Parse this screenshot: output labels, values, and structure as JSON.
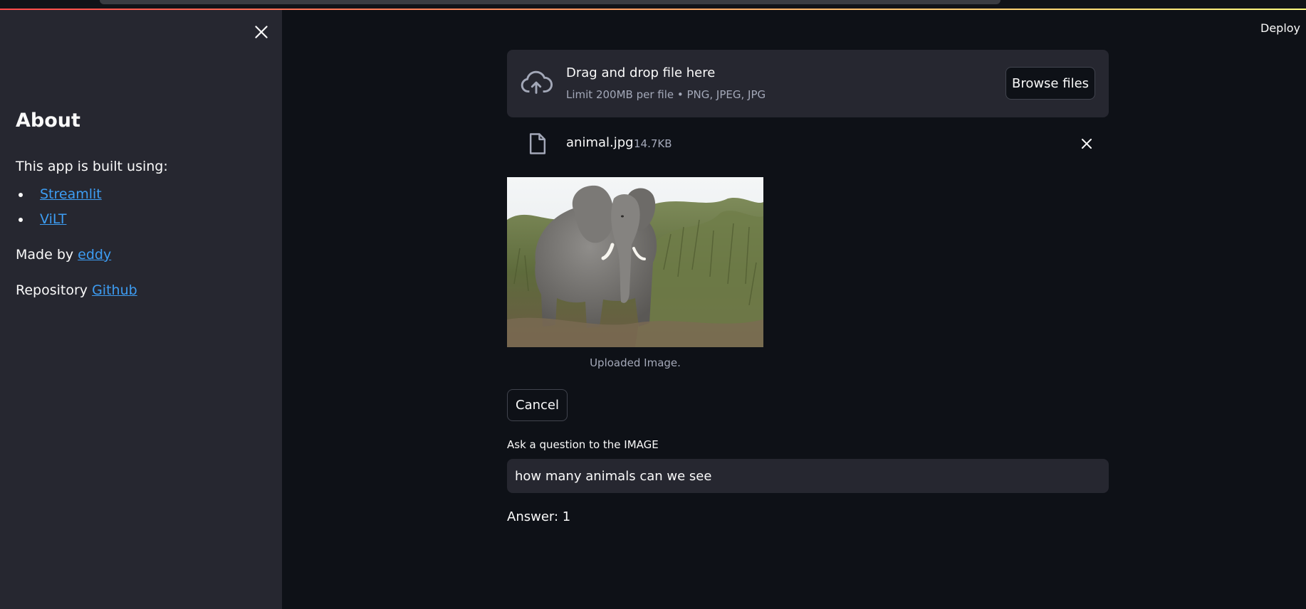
{
  "sidebar": {
    "title": "About",
    "intro": "This app is built using:",
    "links": [
      {
        "label": "Streamlit"
      },
      {
        "label": "ViLT"
      }
    ],
    "made_by_prefix": "Made by ",
    "made_by_link": "eddy",
    "repo_prefix": "Repository ",
    "repo_link": "Github"
  },
  "header": {
    "deploy_label": "Deploy"
  },
  "uploader": {
    "title": "Drag and drop file here",
    "limit": "Limit 200MB per file • PNG, JPEG, JPG",
    "browse_label": "Browse files"
  },
  "file": {
    "name": "animal.jpg",
    "size": "14.7KB"
  },
  "image": {
    "caption": "Uploaded Image."
  },
  "actions": {
    "cancel_label": "Cancel"
  },
  "question": {
    "label": "Ask a question to the IMAGE",
    "value": "how many animals can we see"
  },
  "answer": {
    "text": "Answer: 1"
  },
  "colors": {
    "background": "#0e1117",
    "sidebar": "#262730",
    "link": "#3d9df3",
    "accent_gradient_start": "#ff4b4b",
    "accent_gradient_end": "#fffd80"
  }
}
